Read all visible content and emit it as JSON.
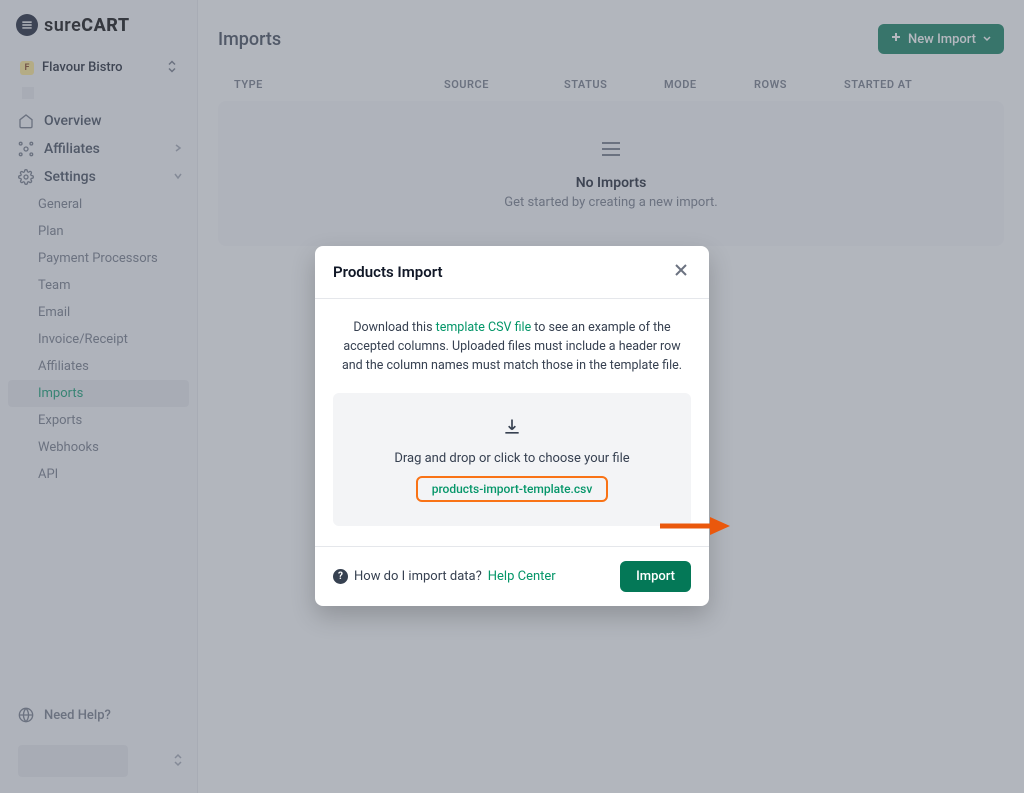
{
  "brand": {
    "prefix": "sure",
    "suffix": "CART"
  },
  "store": {
    "initial": "F",
    "name": "Flavour Bistro"
  },
  "nav": {
    "overview": "Overview",
    "affiliates": "Affiliates",
    "settings": "Settings",
    "sub": {
      "general": "General",
      "plan": "Plan",
      "payment": "Payment Processors",
      "team": "Team",
      "email": "Email",
      "invoice": "Invoice/Receipt",
      "affiliates": "Affiliates",
      "imports": "Imports",
      "exports": "Exports",
      "webhooks": "Webhooks",
      "api": "API"
    },
    "help": "Need Help?"
  },
  "page": {
    "title": "Imports",
    "new_btn": "New Import",
    "headers": {
      "type": "TYPE",
      "source": "SOURCE",
      "status": "STATUS",
      "mode": "MODE",
      "rows": "ROWS",
      "started": "STARTED AT"
    },
    "empty_title": "No Imports",
    "empty_sub": "Get started by creating a new import."
  },
  "modal": {
    "title": "Products Import",
    "help_pre": "Download this ",
    "help_link": "template CSV file",
    "help_post": " to see an example of the accepted columns. Uploaded files must include a header row and the column names must match those in the template file.",
    "drop_text": "Drag and drop or click to choose your file",
    "file_name": "products-import-template.csv",
    "foot_question": "How do I import data?",
    "foot_link": "Help Center",
    "import_btn": "Import"
  }
}
